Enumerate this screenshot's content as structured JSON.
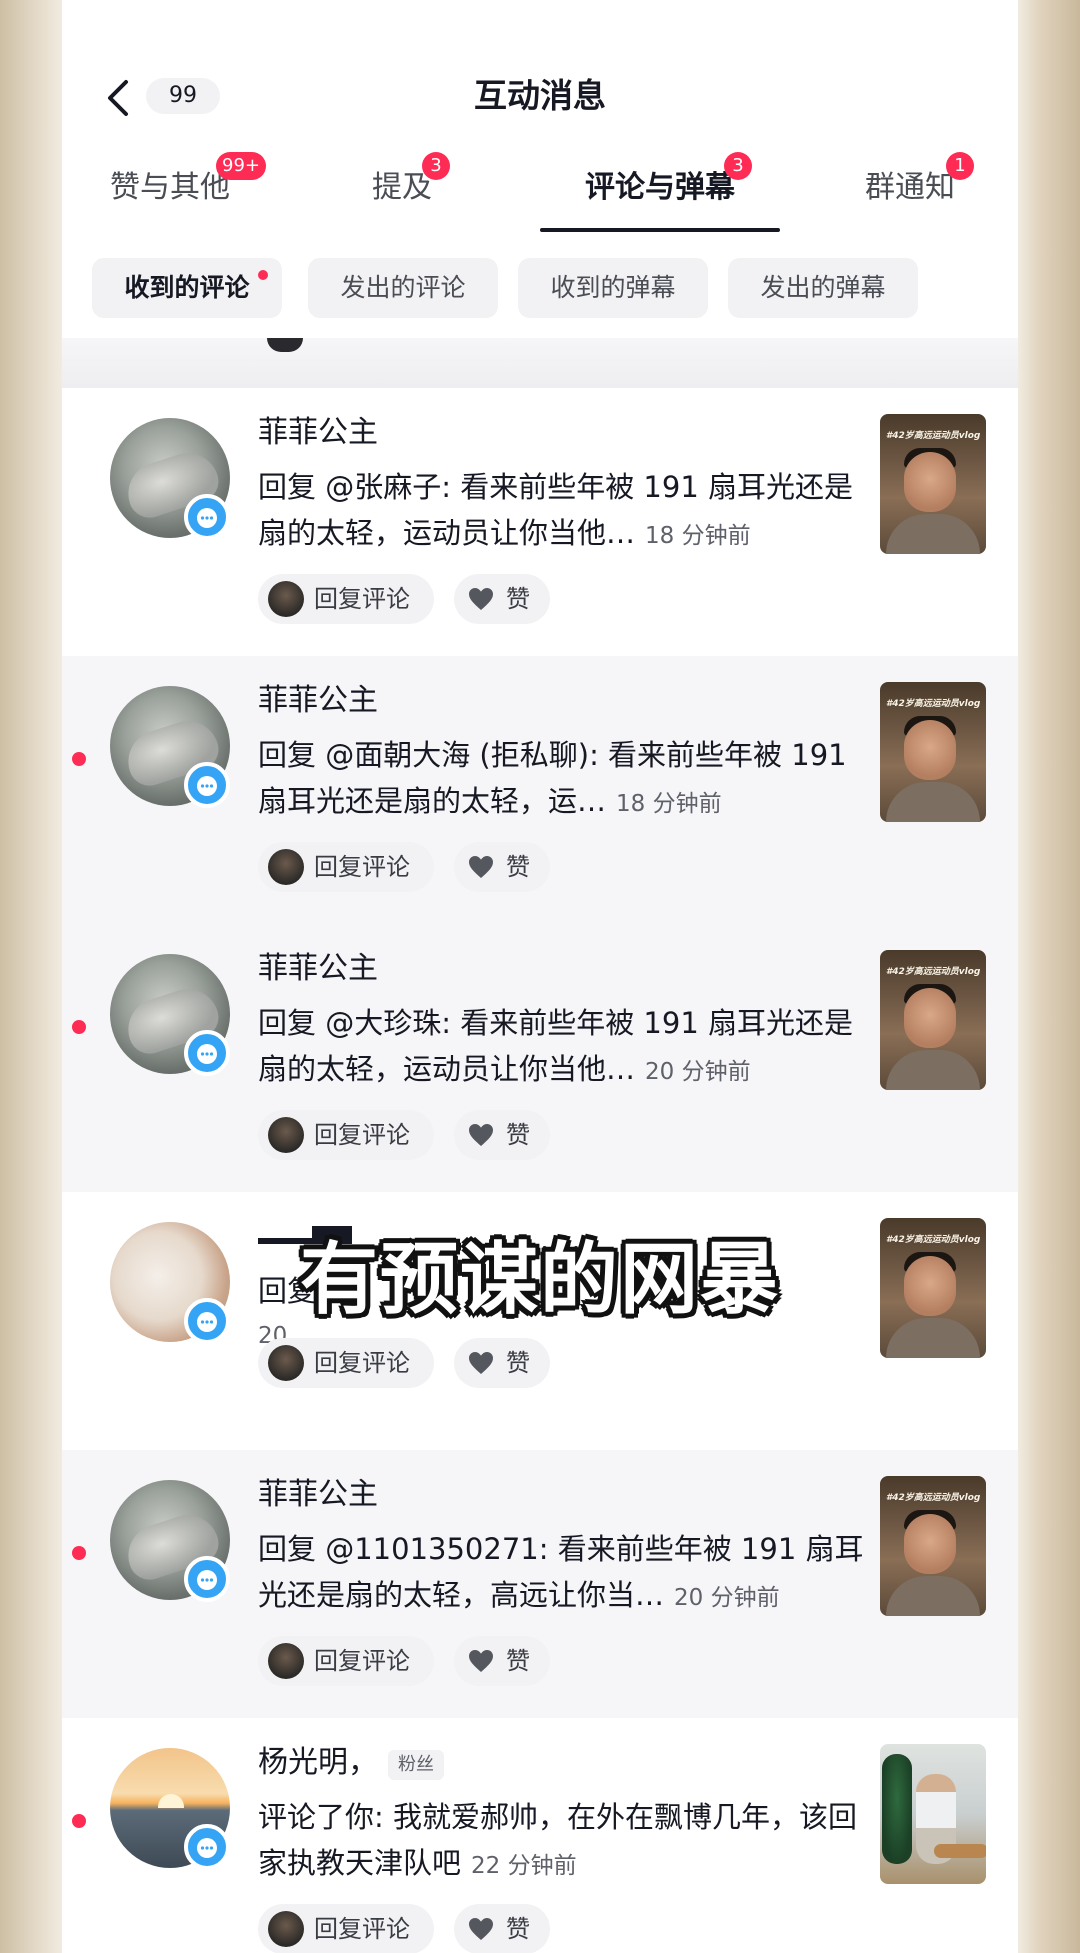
{
  "header": {
    "back_badge": "99",
    "title": "互动消息"
  },
  "tabs": [
    {
      "label": "赞与其他",
      "badge": "99+"
    },
    {
      "label": "提及",
      "badge": "3"
    },
    {
      "label": "评论与弹幕",
      "badge": "3"
    },
    {
      "label": "群通知",
      "badge": "1"
    }
  ],
  "chips": [
    {
      "label": "收到的评论"
    },
    {
      "label": "发出的评论"
    },
    {
      "label": "收到的弹幕"
    },
    {
      "label": "发出的弹幕"
    }
  ],
  "actions": {
    "reply_label": "回复评论",
    "like_label": "赞"
  },
  "items": [
    {
      "name": "菲菲公主",
      "comment": "回复 @张麻子: 看来前些年被 191 扇耳光还是扇的太轻，运动员让你当他…",
      "time": "18 分钟前",
      "thumb_caption": "#42岁高远运动员vlog 2"
    },
    {
      "name": "菲菲公主",
      "comment": "回复 @面朝大海 (拒私聊): 看来前些年被 191 扇耳光还是扇的太轻，运…",
      "time": "18 分钟前",
      "thumb_caption": "#42岁高远运动员vlog 2"
    },
    {
      "name": "菲菲公主",
      "comment": "回复 @大珍珠: 看来前些年被 191 扇耳光还是扇的太轻，运动员让你当他…",
      "time": "20 分钟前",
      "thumb_caption": "#42岁高远运动员vlog 2"
    },
    {
      "comment_partial": "回复",
      "time_partial": "20",
      "thumb_caption": "#42岁高远运动员vlog 2"
    },
    {
      "name": "菲菲公主",
      "comment": "回复 @1101350271: 看来前些年被 191 扇耳光还是扇的太轻，高远让你当…",
      "time": "20 分钟前",
      "thumb_caption": "#42岁高远运动员vlog 2"
    },
    {
      "name": "杨光明，",
      "tag": "粉丝",
      "comment": "评论了你: 我就爱郝帅，在外在飘博几年，该回家执教天津队吧",
      "time": "22 分钟前"
    }
  ],
  "overlay_caption": "有预谋的网暴",
  "colors": {
    "accent": "#fe2c55",
    "bubble": "#35a4f4"
  }
}
